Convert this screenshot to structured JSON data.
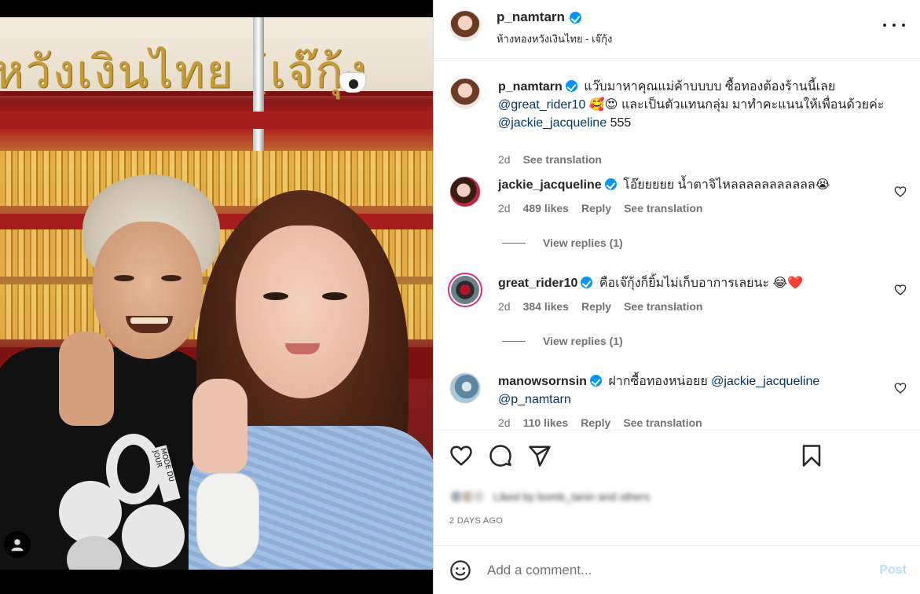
{
  "post": {
    "author": "p_namtarn",
    "location": "ห้างทองหวังเงินไทย - เจ๊กุ้ง",
    "photo_sign_text": "หวังเงินไทย (เจ๊กุ้ง",
    "shirt_print": "MODE DU JOUR",
    "caption": {
      "user": "p_namtarn",
      "text_1": "แว๊บมาหาคุณแม่ค้าบบบบ ซื้อทองต้องร้านนี้เลย",
      "mention_1": "@great_rider10",
      "emoji_1": "🥰😍",
      "text_2": "และเป็นตัวแทนกลุ่ม มาทำคะแนนให้เพื่อนด้วยค่ะ",
      "mention_2": "@jackie_jacqueline",
      "text_3": "555",
      "age": "2d",
      "see_translation": "See translation"
    },
    "comments": [
      {
        "user": "jackie_jacqueline",
        "text": "โอ๊ยยยยย น้ำตาจิไหลลลลลลลลลลล😭",
        "age": "2d",
        "likes": "489 likes",
        "reply": "Reply",
        "see_translation": "See translation",
        "view_replies": "View replies (1)"
      },
      {
        "user": "great_rider10",
        "text": "คือเจ๊กุ้งก็ยิ้มไม่เก็บอาการเลยนะ 😂❤️",
        "age": "2d",
        "likes": "384 likes",
        "reply": "Reply",
        "see_translation": "See translation",
        "view_replies": "View replies (1)"
      },
      {
        "user": "manowsornsin",
        "text": "ฝากซื้อทองหน่อยย",
        "mention_1": "@jackie_jacqueline",
        "mention_2": "@p_namtarn",
        "age": "2d",
        "likes": "110 likes",
        "reply": "Reply",
        "see_translation": "See translation"
      }
    ],
    "likes_summary": "Liked by bomb_tanin and others",
    "timestamp": "2 DAYS AGO",
    "add_comment": {
      "placeholder": "Add a comment...",
      "post_label": "Post"
    }
  },
  "icons": {
    "verified": "verified-badge-icon",
    "more": "more-options-icon",
    "like": "heart-icon",
    "comment": "comment-icon",
    "share": "share-icon",
    "save": "bookmark-icon",
    "emoji": "emoji-icon",
    "tagged": "user-tag-icon"
  },
  "colors": {
    "verified": "#0095f6",
    "mention": "#00376b",
    "secondary_text": "#737373",
    "post_button": "#b2dffc"
  }
}
